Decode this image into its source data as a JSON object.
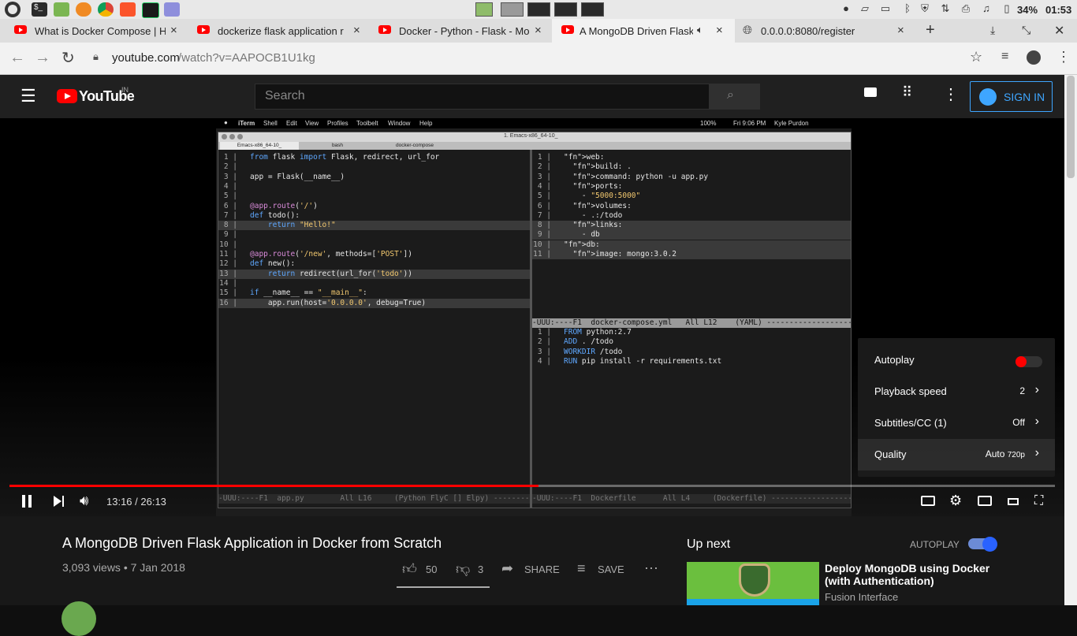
{
  "os": {
    "battery": "34%",
    "clock": "01:53"
  },
  "tabs": [
    {
      "label": "What is Docker Compose | H",
      "close": "×"
    },
    {
      "label": "dockerize flask application r",
      "close": "×"
    },
    {
      "label": "Docker - Python - Flask - Mo",
      "close": "×"
    },
    {
      "label": "A MongoDB Driven Flask",
      "close": "×"
    },
    {
      "label": "0.0.0.0:8080/register",
      "close": "×"
    }
  ],
  "newtab": "+",
  "address": {
    "host": "youtube.com",
    "path": "/watch?v=AAPOCB1U1kg"
  },
  "yt": {
    "logo": "YouTube",
    "region": "IN",
    "search_placeholder": "Search",
    "signin": "SIGN IN"
  },
  "mac": {
    "menus": [
      "iTerm",
      "Shell",
      "Edit",
      "View",
      "Profiles",
      "Toolbelt",
      "Window",
      "Help"
    ],
    "battery": "100%",
    "time": "Fri 9:06 PM",
    "user": "Kyle Purdon",
    "window_title": "1. Emacs-x86_64-10_",
    "tabs": [
      "Emacs-x86_64-10_",
      "bash",
      "docker-compose"
    ]
  },
  "code_left": [
    {
      "n": "1",
      "t": "from flask import Flask, redirect, url_for"
    },
    {
      "n": "2",
      "t": ""
    },
    {
      "n": "3",
      "t": "app = Flask(__name__)"
    },
    {
      "n": "4",
      "t": ""
    },
    {
      "n": "5",
      "t": ""
    },
    {
      "n": "6",
      "t": "@app.route('/')"
    },
    {
      "n": "7",
      "t": "def todo():"
    },
    {
      "n": "8",
      "t": "    return \"Hello!\""
    },
    {
      "n": "9",
      "t": ""
    },
    {
      "n": "10",
      "t": ""
    },
    {
      "n": "11",
      "t": "@app.route('/new', methods=['POST'])"
    },
    {
      "n": "12",
      "t": "def new():"
    },
    {
      "n": "13",
      "t": "    return redirect(url_for('todo'))"
    },
    {
      "n": "14",
      "t": ""
    },
    {
      "n": "15",
      "t": "if __name__ == \"__main__\":"
    },
    {
      "n": "16",
      "t": "    app.run(host='0.0.0.0', debug=True)"
    }
  ],
  "code_right_top": [
    {
      "n": "1",
      "t": "web:"
    },
    {
      "n": "2",
      "t": "  build: ."
    },
    {
      "n": "3",
      "t": "  command: python -u app.py"
    },
    {
      "n": "4",
      "t": "  ports:"
    },
    {
      "n": "5",
      "t": "    - \"5000:5000\""
    },
    {
      "n": "6",
      "t": "  volumes:"
    },
    {
      "n": "7",
      "t": "    - .:/todo"
    },
    {
      "n": "8",
      "t": "  links:"
    },
    {
      "n": "9",
      "t": "    - db"
    },
    {
      "n": "10",
      "t": "db:"
    },
    {
      "n": "11",
      "t": "  image: mongo:3.0.2"
    }
  ],
  "modeline_right_top": "-UUU:----F1  docker-compose.yml   All L12    (YAML) --------------------",
  "code_right_bottom": [
    {
      "n": "1",
      "t": "FROM python:2.7"
    },
    {
      "n": "2",
      "t": "ADD . /todo"
    },
    {
      "n": "3",
      "t": "WORKDIR /todo"
    },
    {
      "n": "4",
      "t": "RUN pip install -r requirements.txt"
    }
  ],
  "modeline_left": "-UUU:----F1  app.py        All L16     (Python FlyC [] Elpy) ---------",
  "modeline_right_bottom": "-UUU:----F1  Dockerfile      All L4     (Dockerfile) --------------------",
  "settings": {
    "autoplay_label": "Autoplay",
    "autoplay_on": true,
    "speed_label": "Playback speed",
    "speed_value": "2",
    "subs_label": "Subtitles/CC (1)",
    "subs_value": "Off",
    "quality_label": "Quality",
    "quality_value": "Auto",
    "quality_res": "720p"
  },
  "player": {
    "time": "13:16 / 26:13",
    "progress": 0.506,
    "buffered": 0.506
  },
  "video": {
    "title": "A MongoDB Driven Flask Application in Docker from Scratch",
    "meta": "3,093 views • 7 Jan 2018",
    "likes": "50",
    "dislikes": "3",
    "share": "SHARE",
    "save": "SAVE"
  },
  "upnext": {
    "heading": "Up next",
    "autoplay": "AUTOPLAY",
    "item_title_1": "Deploy MongoDB using Docker",
    "item_title_2": "(with Authentication)",
    "item_channel": "Fusion Interface"
  },
  "colors": {
    "yt_red": "#ff0000",
    "signin_blue": "#3ea6ff",
    "autoplay_blue": "#2962ff"
  }
}
